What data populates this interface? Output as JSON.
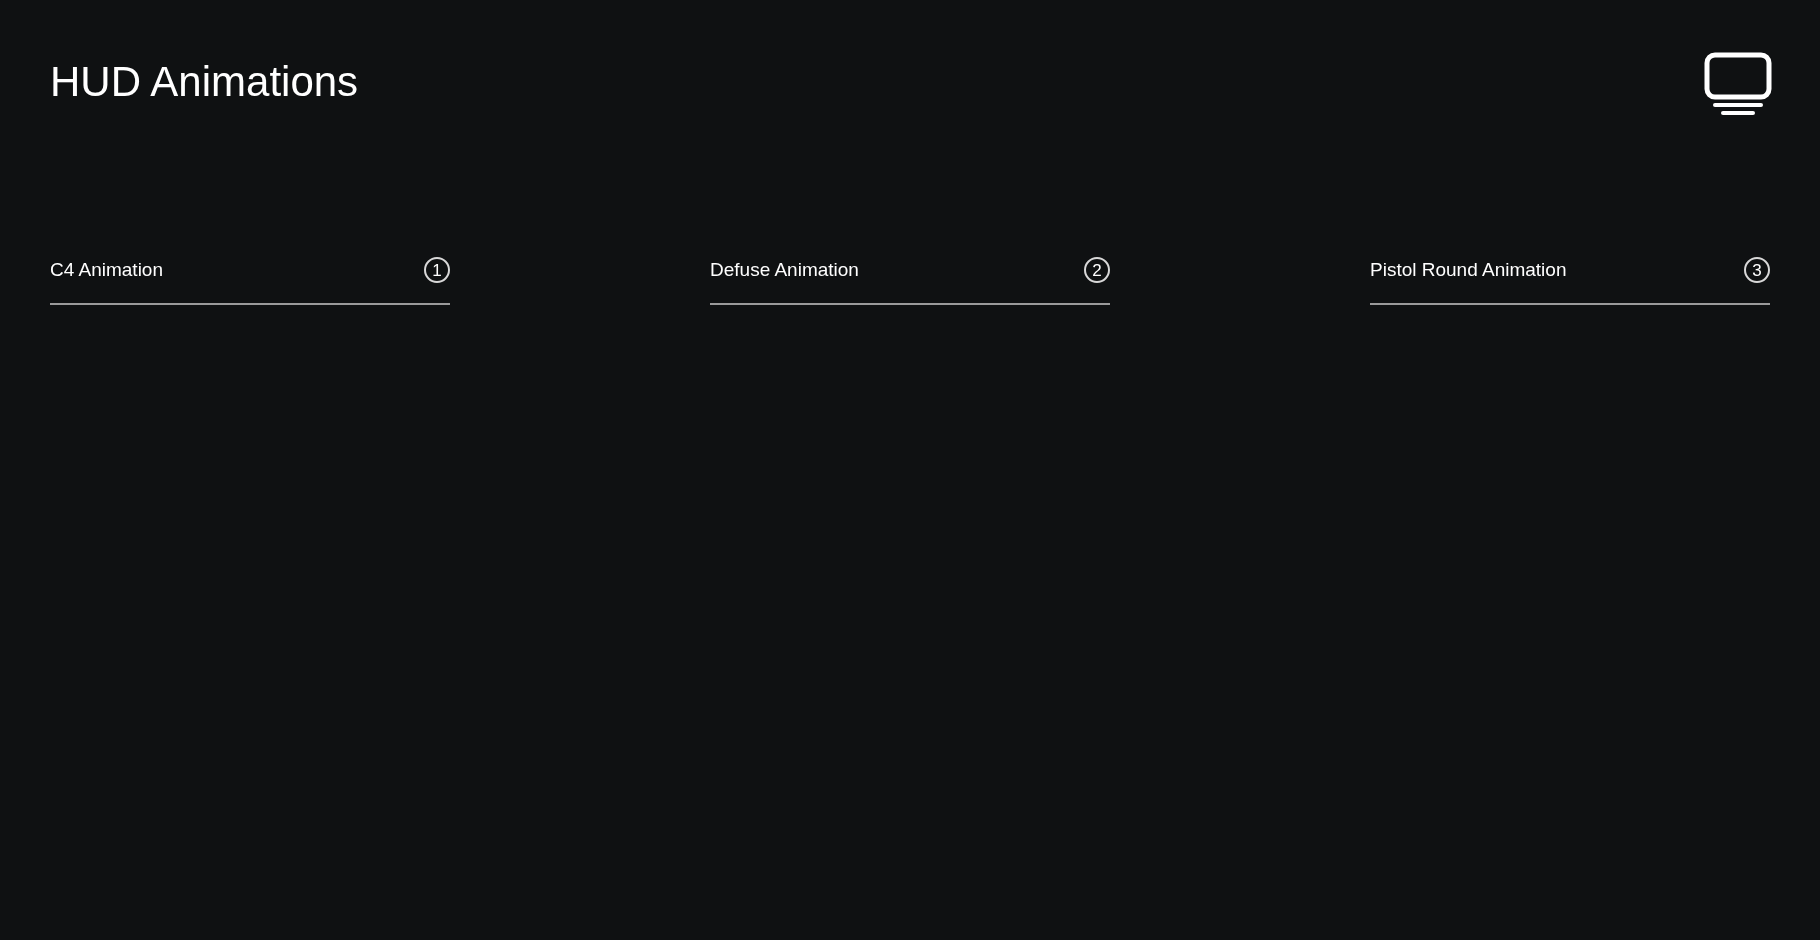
{
  "title": "HUD Animations",
  "items": [
    {
      "label": "C4 Animation",
      "number": "1"
    },
    {
      "label": "Defuse Animation",
      "number": "2"
    },
    {
      "label": "Pistol Round Animation",
      "number": "3"
    }
  ]
}
